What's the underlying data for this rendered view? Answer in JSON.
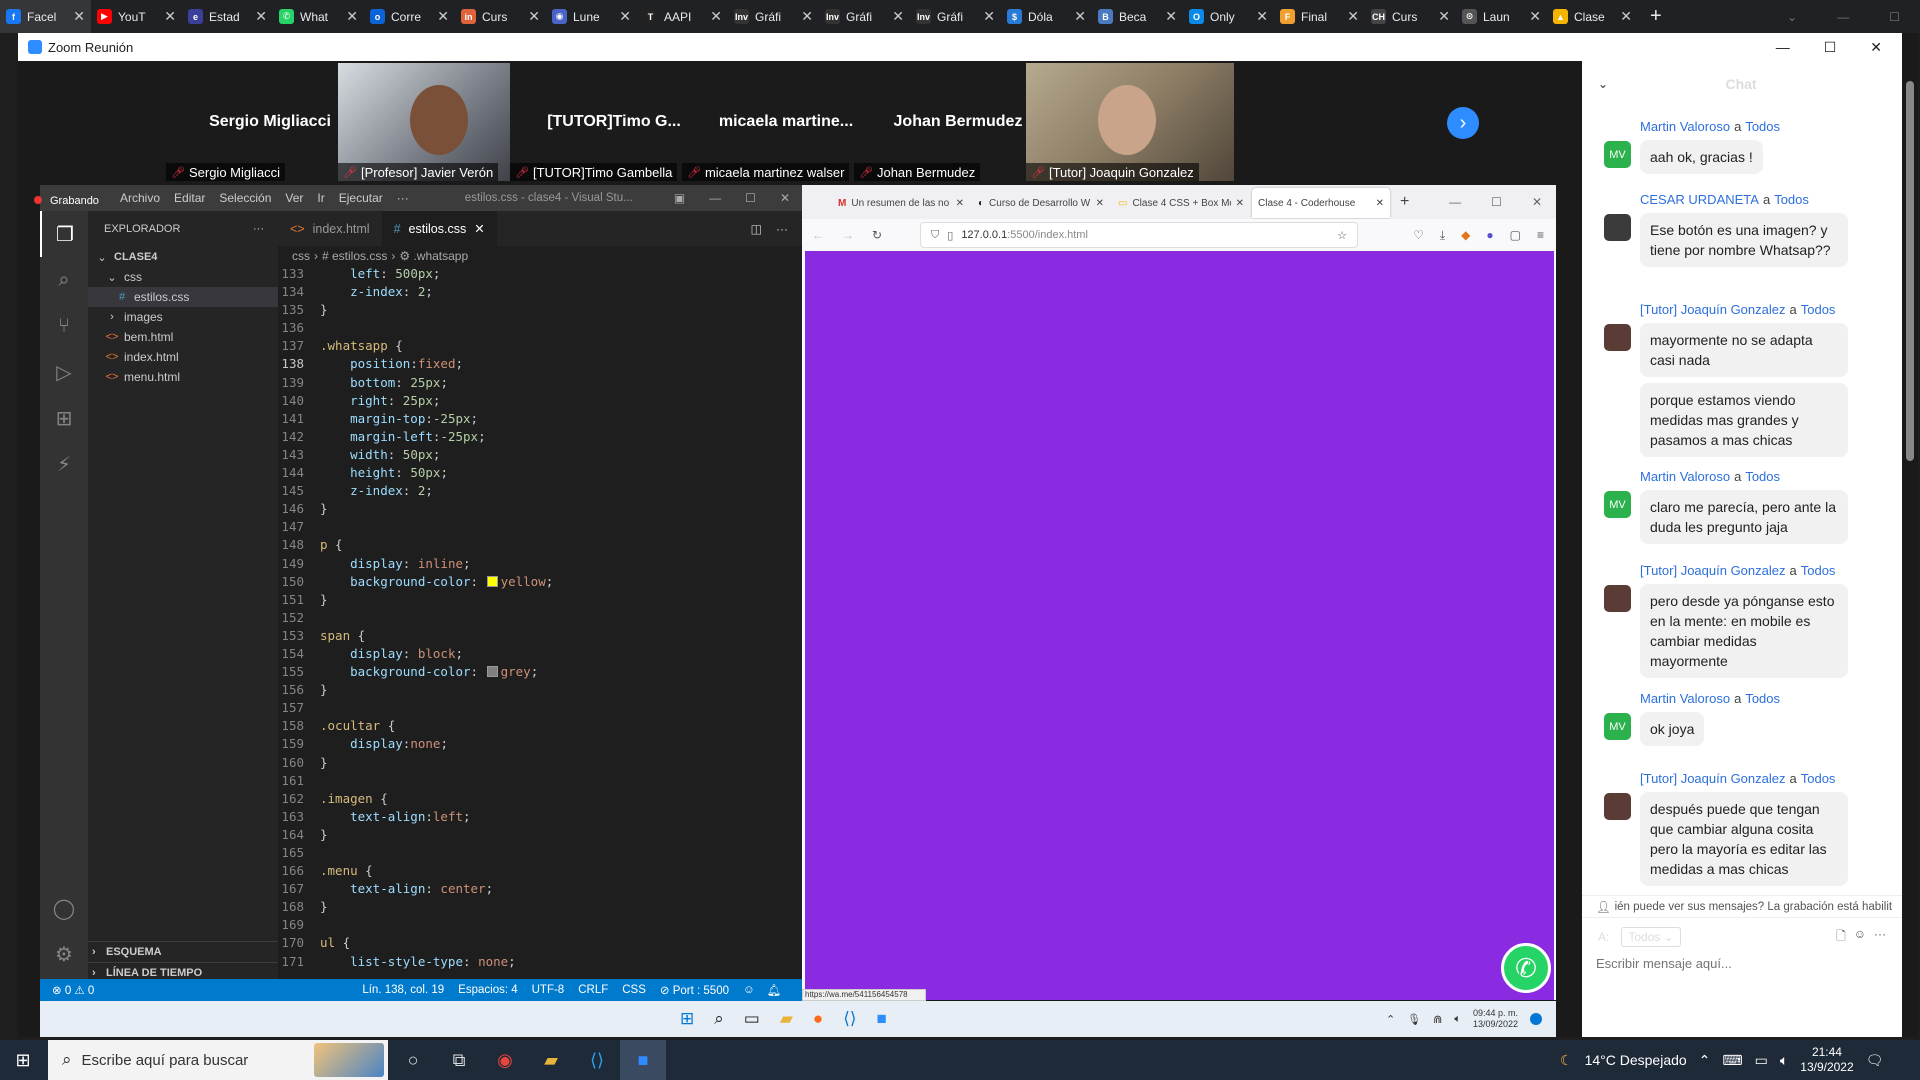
{
  "browser_tabs": [
    {
      "label": "Facel",
      "color": "#1877f2",
      "glyph": "f",
      "active": true
    },
    {
      "label": "YouT",
      "color": "#ff0000",
      "glyph": "▶"
    },
    {
      "label": "Estad",
      "color": "#3a3f9a",
      "glyph": "e"
    },
    {
      "label": "What",
      "color": "#25d366",
      "glyph": "✆"
    },
    {
      "label": "Corre",
      "color": "#0a64d8",
      "glyph": "o"
    },
    {
      "label": "Curs",
      "color": "#e0623a",
      "glyph": "in"
    },
    {
      "label": "Lune",
      "color": "#4a63c6",
      "glyph": "◉"
    },
    {
      "label": "AAPI",
      "color": "#222",
      "glyph": "T"
    },
    {
      "label": "Gráfi",
      "color": "#333",
      "glyph": "Inv"
    },
    {
      "label": "Gráfi",
      "color": "#333",
      "glyph": "Inv"
    },
    {
      "label": "Gráfi",
      "color": "#333",
      "glyph": "Inv"
    },
    {
      "label": "Dóla",
      "color": "#2a7bd8",
      "glyph": "$"
    },
    {
      "label": "Beca",
      "color": "#4a7ac0",
      "glyph": "B"
    },
    {
      "label": "Only",
      "color": "#0a8ae8",
      "glyph": "O"
    },
    {
      "label": "Final",
      "color": "#f0a030",
      "glyph": "F"
    },
    {
      "label": "Curs",
      "color": "#444",
      "glyph": "CH"
    },
    {
      "label": "Laun",
      "color": "#555",
      "glyph": "⊙"
    },
    {
      "label": "Clase",
      "color": "#f6b400",
      "glyph": "▲"
    }
  ],
  "zoom": {
    "title": "Zoom Reunión",
    "recording": "Grabando",
    "participants": [
      {
        "name": "Sergio Migliacci",
        "label": "Sergio Migliacci",
        "video": false
      },
      {
        "name": "",
        "label": "[Profesor] Javier Verón",
        "video": true
      },
      {
        "name": "[TUTOR]Timo G...",
        "label": "[TUTOR]Timo Gambella",
        "video": false
      },
      {
        "name": "micaela  martine...",
        "label": "micaela martinez walser",
        "video": false
      },
      {
        "name": "Johan Bermudez",
        "label": "Johan Bermudez",
        "video": false
      },
      {
        "name": "",
        "label": "[Tutor] Joaquin Gonzalez",
        "video": true
      }
    ]
  },
  "vscode": {
    "menu": [
      "Archivo",
      "Editar",
      "Selección",
      "Ver",
      "Ir",
      "Ejecutar",
      "···"
    ],
    "window_title": "estilos.css - clase4 - Visual Stu...",
    "explorer_title": "EXPLORADOR",
    "tree": [
      {
        "label": "CLASE4",
        "level": 0,
        "kind": "root"
      },
      {
        "label": "css",
        "level": 1,
        "kind": "folder-open"
      },
      {
        "label": "estilos.css",
        "level": 2,
        "kind": "css",
        "selected": true
      },
      {
        "label": "images",
        "level": 1,
        "kind": "folder"
      },
      {
        "label": "bem.html",
        "level": 1,
        "kind": "html"
      },
      {
        "label": "index.html",
        "level": 1,
        "kind": "html"
      },
      {
        "label": "menu.html",
        "level": 1,
        "kind": "html"
      }
    ],
    "outline": "ESQUEMA",
    "timeline": "LÍNEA DE TIEMPO",
    "tabs": [
      {
        "label": "index.html",
        "active": false
      },
      {
        "label": "estilos.css",
        "active": true
      }
    ],
    "breadcrumb": [
      "css",
      "#  estilos.css",
      "⚙ .whatsapp"
    ],
    "code": [
      {
        "n": "133",
        "t": [
          [
            "prop",
            "    left"
          ],
          [
            "pun",
            ": "
          ],
          [
            "num",
            "500px"
          ],
          [
            "pun",
            ";"
          ]
        ]
      },
      {
        "n": "134",
        "t": [
          [
            "prop",
            "    z-index"
          ],
          [
            "pun",
            ": "
          ],
          [
            "num",
            "2"
          ],
          [
            "pun",
            ";"
          ]
        ]
      },
      {
        "n": "135",
        "t": [
          [
            "pun",
            "}"
          ]
        ]
      },
      {
        "n": "136",
        "t": []
      },
      {
        "n": "137",
        "t": [
          [
            "sel",
            ".whatsapp"
          ],
          [
            "pun",
            " {"
          ]
        ]
      },
      {
        "n": "138",
        "t": [
          [
            "prop",
            "    position"
          ],
          [
            "pun",
            ":"
          ],
          [
            "val",
            "fixed"
          ],
          [
            "pun",
            ";"
          ]
        ],
        "cur": true
      },
      {
        "n": "139",
        "t": [
          [
            "prop",
            "    bottom"
          ],
          [
            "pun",
            ": "
          ],
          [
            "num",
            "25px"
          ],
          [
            "pun",
            ";"
          ]
        ]
      },
      {
        "n": "140",
        "t": [
          [
            "prop",
            "    right"
          ],
          [
            "pun",
            ": "
          ],
          [
            "num",
            "25px"
          ],
          [
            "pun",
            ";"
          ]
        ]
      },
      {
        "n": "141",
        "t": [
          [
            "prop",
            "    margin-top"
          ],
          [
            "pun",
            ":"
          ],
          [
            "num",
            "-25px"
          ],
          [
            "pun",
            ";"
          ]
        ]
      },
      {
        "n": "142",
        "t": [
          [
            "prop",
            "    margin-left"
          ],
          [
            "pun",
            ":"
          ],
          [
            "num",
            "-25px"
          ],
          [
            "pun",
            ";"
          ]
        ]
      },
      {
        "n": "143",
        "t": [
          [
            "prop",
            "    width"
          ],
          [
            "pun",
            ": "
          ],
          [
            "num",
            "50px"
          ],
          [
            "pun",
            ";"
          ]
        ]
      },
      {
        "n": "144",
        "t": [
          [
            "prop",
            "    height"
          ],
          [
            "pun",
            ": "
          ],
          [
            "num",
            "50px"
          ],
          [
            "pun",
            ";"
          ]
        ]
      },
      {
        "n": "145",
        "t": [
          [
            "prop",
            "    z-index"
          ],
          [
            "pun",
            ": "
          ],
          [
            "num",
            "2"
          ],
          [
            "pun",
            ";"
          ]
        ]
      },
      {
        "n": "146",
        "t": [
          [
            "pun",
            "}"
          ]
        ]
      },
      {
        "n": "147",
        "t": []
      },
      {
        "n": "148",
        "t": [
          [
            "sel",
            "p"
          ],
          [
            "pun",
            " {"
          ]
        ]
      },
      {
        "n": "149",
        "t": [
          [
            "prop",
            "    display"
          ],
          [
            "pun",
            ": "
          ],
          [
            "val",
            "inline"
          ],
          [
            "pun",
            ";"
          ]
        ]
      },
      {
        "n": "150",
        "t": [
          [
            "prop",
            "    background-color"
          ],
          [
            "pun",
            ": "
          ],
          [
            "swatch",
            "#ffff00"
          ],
          [
            "val",
            "yellow"
          ],
          [
            "pun",
            ";"
          ]
        ]
      },
      {
        "n": "151",
        "t": [
          [
            "pun",
            "}"
          ]
        ]
      },
      {
        "n": "152",
        "t": []
      },
      {
        "n": "153",
        "t": [
          [
            "sel",
            "span"
          ],
          [
            "pun",
            " {"
          ]
        ]
      },
      {
        "n": "154",
        "t": [
          [
            "prop",
            "    display"
          ],
          [
            "pun",
            ": "
          ],
          [
            "val",
            "block"
          ],
          [
            "pun",
            ";"
          ]
        ]
      },
      {
        "n": "155",
        "t": [
          [
            "prop",
            "    background-color"
          ],
          [
            "pun",
            ": "
          ],
          [
            "swatch",
            "#808080"
          ],
          [
            "val",
            "grey"
          ],
          [
            "pun",
            ";"
          ]
        ]
      },
      {
        "n": "156",
        "t": [
          [
            "pun",
            "}"
          ]
        ]
      },
      {
        "n": "157",
        "t": []
      },
      {
        "n": "158",
        "t": [
          [
            "sel",
            ".ocultar"
          ],
          [
            "pun",
            " {"
          ]
        ]
      },
      {
        "n": "159",
        "t": [
          [
            "prop",
            "    display"
          ],
          [
            "pun",
            ":"
          ],
          [
            "val",
            "none"
          ],
          [
            "pun",
            ";"
          ]
        ]
      },
      {
        "n": "160",
        "t": [
          [
            "pun",
            "}"
          ]
        ]
      },
      {
        "n": "161",
        "t": []
      },
      {
        "n": "162",
        "t": [
          [
            "sel",
            ".imagen"
          ],
          [
            "pun",
            " {"
          ]
        ]
      },
      {
        "n": "163",
        "t": [
          [
            "prop",
            "    text-align"
          ],
          [
            "pun",
            ":"
          ],
          [
            "val",
            "left"
          ],
          [
            "pun",
            ";"
          ]
        ]
      },
      {
        "n": "164",
        "t": [
          [
            "pun",
            "}"
          ]
        ]
      },
      {
        "n": "165",
        "t": []
      },
      {
        "n": "166",
        "t": [
          [
            "sel",
            ".menu"
          ],
          [
            "pun",
            " {"
          ]
        ]
      },
      {
        "n": "167",
        "t": [
          [
            "prop",
            "    text-align"
          ],
          [
            "pun",
            ": "
          ],
          [
            "val",
            "center"
          ],
          [
            "pun",
            ";"
          ]
        ]
      },
      {
        "n": "168",
        "t": [
          [
            "pun",
            "}"
          ]
        ]
      },
      {
        "n": "169",
        "t": []
      },
      {
        "n": "170",
        "t": [
          [
            "sel",
            "ul"
          ],
          [
            "pun",
            " {"
          ]
        ]
      },
      {
        "n": "171",
        "t": [
          [
            "prop",
            "    list-style-type"
          ],
          [
            "pun",
            ": "
          ],
          [
            "val",
            "none"
          ],
          [
            "pun",
            ";"
          ]
        ]
      }
    ],
    "status": {
      "errors": "⊗ 0 ⚠ 0",
      "position": "Lín. 138, col. 19",
      "spaces": "Espacios: 4",
      "encoding": "UTF-8",
      "eol": "CRLF",
      "lang": "CSS",
      "port": "⊘ Port : 5500"
    }
  },
  "firefox": {
    "tabs": [
      {
        "label": "Un resumen de las no",
        "icon": "M",
        "color": "#d93025"
      },
      {
        "label": "Curso de Desarrollo W",
        "icon": "◐",
        "color": "#222"
      },
      {
        "label": "Clase 4 CSS + Box Mo",
        "icon": "▭",
        "color": "#f6b400"
      },
      {
        "label": "Clase 4 - Coderhouse",
        "icon": "",
        "color": "#fff",
        "active": true
      }
    ],
    "url_host": "127.0.0.1",
    "url_rest": ":5500/index.html",
    "page_bg": "#8a2be2",
    "link_hint": "https://wa.me/541156454578"
  },
  "mini_taskbar": {
    "time": "09:44 p. m.",
    "date": "13/09/2022"
  },
  "chat": {
    "title": "Chat",
    "messages": [
      {
        "from": "Martin Valoroso",
        "to": "Todos",
        "initials": "MV",
        "avatar_color": "#2bb24c",
        "bubbles": [
          "aah ok, gracias !"
        ]
      },
      {
        "from": "CESAR URDANETA",
        "to": "Todos",
        "initials": "",
        "avatar_color": "#3b3b3b",
        "bubbles": [
          "Ese botón es una imagen? y tiene por nombre Whatsap??"
        ]
      },
      {
        "from": "[Tutor] Joaquín Gonzalez",
        "to": "Todos",
        "initials": "",
        "avatar_color": "#5a3b35",
        "bubbles": [
          "mayormente no se adapta casi nada",
          "porque estamos viendo medidas mas grandes y pasamos a mas chicas"
        ]
      },
      {
        "from": "Martin Valoroso",
        "to": "Todos",
        "initials": "MV",
        "avatar_color": "#2bb24c",
        "bubbles": [
          "claro me parecía, pero ante la duda les pregunto jaja"
        ]
      },
      {
        "from": "[Tutor] Joaquín Gonzalez",
        "to": "Todos",
        "initials": "",
        "avatar_color": "#5a3b35",
        "bubbles": [
          "pero desde ya pónganse esto en la mente: en mobile es cambiar medidas mayormente"
        ]
      },
      {
        "from": "Martin Valoroso",
        "to": "Todos",
        "initials": "MV",
        "avatar_color": "#2bb24c",
        "bubbles": [
          "ok joya"
        ]
      },
      {
        "from": "[Tutor] Joaquín Gonzalez",
        "to": "Todos",
        "initials": "",
        "avatar_color": "#5a3b35",
        "bubbles": [
          "después puede que tengan que cambiar alguna cosita pero la mayoría es editar las medidas a mas chicas"
        ]
      }
    ],
    "connector": "a",
    "notice": "ién puede ver sus mensajes? La grabación está habilit",
    "to_label": "A:",
    "to_value": "Todos",
    "placeholder": "Escribir mensaje aquí..."
  },
  "taskbar": {
    "search_placeholder": "Escribe aquí para buscar",
    "weather": "14°C  Despejado",
    "time": "21:44",
    "date": "13/9/2022"
  }
}
